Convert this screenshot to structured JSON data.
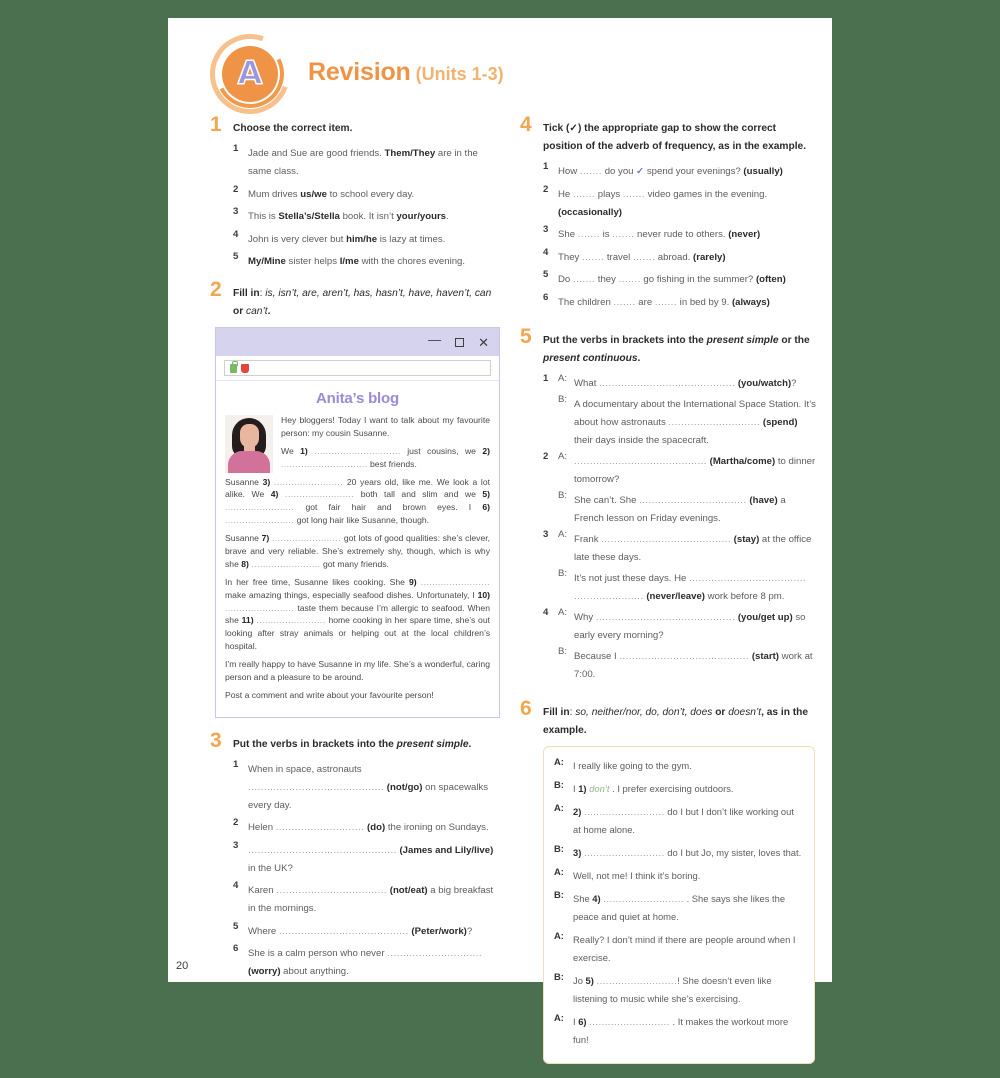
{
  "page": {
    "number": "20",
    "module_letter": "A",
    "title": "Revision",
    "units": "(Units 1-3)"
  },
  "exercises": {
    "ex1": {
      "number": "1",
      "instruction": "Choose the correct item.",
      "items": [
        {
          "num": "1",
          "html": "Jade and Sue are good friends. <b>Them/They</b> are in the same class."
        },
        {
          "num": "2",
          "html": "Mum drives <b>us/we</b> to school every day."
        },
        {
          "num": "3",
          "html": "This is <b>Stella&rsquo;s/Stella</b> book. It isn&rsquo;t <b>your/yours</b>."
        },
        {
          "num": "4",
          "html": "John is very clever but <b>him/he</b> is lazy at times."
        },
        {
          "num": "5",
          "html": "<b>My/Mine</b> sister helps <b>I/me</b> with the chores evening."
        }
      ]
    },
    "ex2": {
      "number": "2",
      "instruction_html": "Fill in<span class=\"norm\">:</span> <i class=\"norm\">is, isn&rsquo;t, are, aren&rsquo;t, has, hasn&rsquo;t, have, haven&rsquo;t, can</i> or <i class=\"norm\">can&rsquo;t</i>.",
      "window": {
        "title_buttons": [
          "minimize",
          "maximize",
          "close"
        ],
        "blog_title": "Anita&rsquo;s blog",
        "paragraphs": [
          "Hey bloggers! Today I want to talk about my favourite person: my cousin Susanne.",
          "We <b>1)</b> <span class=\"dots\">..............................</span> just cousins, we <b>2)</b> <span class=\"dots\">..............................</span> best friends.",
          "Susanne <b>3)</b> <span class=\"dots\">........................</span> 20 years old, like me. We look a lot alike. We <b>4)</b> <span class=\"dots\">........................</span> both tall and slim and we <b>5)</b> <span class=\"dots\">........................</span> got fair hair and brown eyes. I <b>6)</b> <span class=\"dots\">........................</span> got long hair like Susanne, though.",
          "Susanne <b>7)</b> <span class=\"dots\">........................</span> got lots of good qualities: she&rsquo;s clever, brave and very reliable. She&rsquo;s extremely shy, though, which is why she <b>8)</b> <span class=\"dots\">........................</span> got many friends.",
          "In her free time, Susanne likes cooking. She <b>9)</b> <span class=\"dots\">........................</span> make amazing things, especially seafood dishes. Unfortunately, I <b>10)</b> <span class=\"dots\">........................</span> taste them because I&rsquo;m allergic to seafood. When she <b>11)</b> <span class=\"dots\">........................</span> home cooking in her spare time, she&rsquo;s out looking after stray animals or helping out at the local children&rsquo;s hospital.",
          "I&rsquo;m really happy to have Susanne in my life. She&rsquo;s a wonderful, caring person and a pleasure to be around.",
          "Post a comment and write about your favourite person!"
        ]
      }
    },
    "ex3": {
      "number": "3",
      "instruction_html": "Put the verbs in brackets into the <i>present simple</i>.",
      "items": [
        {
          "num": "1",
          "html": "When in space, astronauts <span class=\"dots\">...........................................</span> <b>(not/go)</b> on spacewalks every day."
        },
        {
          "num": "2",
          "html": "Helen <span class=\"dots\">............................</span> <b>(do)</b> the ironing on Sundays."
        },
        {
          "num": "3",
          "html": "<span class=\"dots\">...............................................</span> <b>(James and Lily/live)</b> in the UK?"
        },
        {
          "num": "4",
          "html": "Karen <span class=\"dots\">...................................</span> <b>(not/eat)</b> a big breakfast in the mornings."
        },
        {
          "num": "5",
          "html": "Where <span class=\"dots\">.........................................</span> <b>(Peter/work)</b>?"
        },
        {
          "num": "6",
          "html": "She is a calm person who never <span class=\"dots\">..............................</span> <b>(worry)</b> about anything."
        }
      ]
    },
    "ex4": {
      "number": "4",
      "instruction_html": "Tick (&#10003;) the appropriate gap to show the correct position of the adverb of frequency, as in the example.",
      "items": [
        {
          "num": "1",
          "html": "How <span class=\"dots\">.......</span> do you <span class=\"tick\">&#10003;</span> spend your evenings? <b>(usually)</b>"
        },
        {
          "num": "2",
          "html": "He <span class=\"dots\">.......</span> plays <span class=\"dots\">.......</span> video games in the evening. <b>(occasionally)</b>"
        },
        {
          "num": "3",
          "html": "She <span class=\"dots\">.......</span> is <span class=\"dots\">.......</span> never rude to others. <b>(never)</b>"
        },
        {
          "num": "4",
          "html": "They <span class=\"dots\">.......</span> travel <span class=\"dots\">.......</span> abroad. <b>(rarely)</b>"
        },
        {
          "num": "5",
          "html": "Do <span class=\"dots\">.......</span> they <span class=\"dots\">.......</span> go fishing in the summer? <b>(often)</b>"
        },
        {
          "num": "6",
          "html": "The children <span class=\"dots\">.......</span> are <span class=\"dots\">.......</span> in bed by 9. <b>(always)</b>"
        }
      ]
    },
    "ex5": {
      "number": "5",
      "instruction_html": "Put the verbs in brackets into the <i>present simple</i> or the <i>present continuous</i>.",
      "items": [
        {
          "num": "1",
          "lines": [
            {
              "spk": "A:",
              "html": "What <span class=\"dots\">...........................................</span> <b>(you/watch)</b>?"
            },
            {
              "spk": "B:",
              "html": "A documentary about the International Space Station. It&rsquo;s about how astronauts <span class=\"dots\">.............................</span> <b>(spend)</b> their days inside the spacecraft."
            }
          ]
        },
        {
          "num": "2",
          "lines": [
            {
              "spk": "A:",
              "html": "<span class=\"dots\">..........................................</span> <b>(Martha/come)</b> to dinner tomorrow?"
            },
            {
              "spk": "B:",
              "html": "She can&rsquo;t. She <span class=\"dots\">..................................</span> <b>(have)</b> a French lesson on Friday evenings."
            }
          ]
        },
        {
          "num": "3",
          "lines": [
            {
              "spk": "A:",
              "html": "Frank <span class=\"dots\">.........................................</span> <b>(stay)</b> at the office late these days."
            },
            {
              "spk": "B:",
              "html": "It&rsquo;s not just these days. He <span class=\"dots\">.....................................</span> <span class=\"dots\">......................</span> <b>(never/leave)</b> work before 8 pm."
            }
          ]
        },
        {
          "num": "4",
          "lines": [
            {
              "spk": "A:",
              "html": "Why <span class=\"dots\">............................................</span> <b>(you/get up)</b> so early every morning?"
            },
            {
              "spk": "B:",
              "html": "Because I <span class=\"dots\">.........................................</span> <b>(start)</b> work at 7:00."
            }
          ]
        }
      ]
    },
    "ex6": {
      "number": "6",
      "instruction_html": "Fill in<span class=\"norm\">:</span> <i class=\"norm\">so, neither/nor, do, don&rsquo;t, does</i> or <i class=\"norm\">doesn&rsquo;t</i>, as in the example.",
      "dialogue": [
        {
          "spk": "A:",
          "html": "I really like going to the gym."
        },
        {
          "spk": "B:",
          "html": "I <b>1)</b> <i>don&rsquo;t</i> . I prefer exercising outdoors."
        },
        {
          "spk": "A:",
          "html": "<b>2)</b> <span class=\"dots\">..........................</span> do I but I don&rsquo;t like working out at home alone."
        },
        {
          "spk": "B:",
          "html": "<b>3)</b> <span class=\"dots\">..........................</span> do I but Jo, my sister, loves that."
        },
        {
          "spk": "A:",
          "html": "Well, not me! I think it&rsquo;s boring."
        },
        {
          "spk": "B:",
          "html": "She <b>4)</b> <span class=\"dots\">..........................</span> . She says she likes the peace and quiet at home."
        },
        {
          "spk": "A:",
          "html": "Really? I don&rsquo;t mind if there are people around when I exercise."
        },
        {
          "spk": "B:",
          "html": "Jo <b>5)</b> <span class=\"dots\">..........................</span>! She doesn&rsquo;t even like listening to music while she&rsquo;s exercising."
        },
        {
          "spk": "A:",
          "html": "I <b>6)</b> <span class=\"dots\">..........................</span> . It makes the workout more fun!"
        }
      ]
    }
  },
  "colors": {
    "accent_orange": "#ef9347",
    "number_orange": "#f2a74f",
    "blog_purple": "#9b8ad6",
    "titlebar_purple": "#d6d3ee",
    "page_bg": "#ffffff",
    "canvas_bg": "#4a7050"
  }
}
